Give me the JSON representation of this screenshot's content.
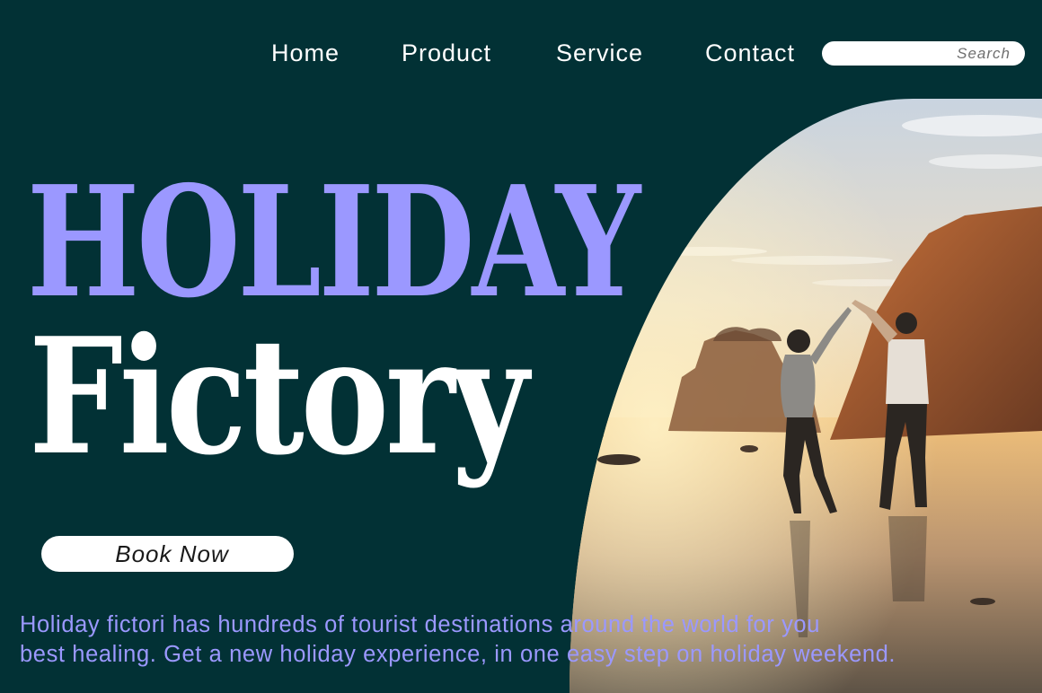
{
  "nav": {
    "items": [
      "Home",
      "Product",
      "Service",
      "Contact"
    ],
    "search_placeholder": "Search"
  },
  "hero": {
    "title_line1": "HOLIDAY",
    "title_line2": "Fictory",
    "cta_label": "Book Now",
    "description_line1": "Holiday fictori has hundreds of tourist destinations around the world for you",
    "description_line2": "best healing. Get a new holiday experience, in one easy step on holiday weekend."
  },
  "image": {
    "subject": "couple-dancing-on-beach-at-sunset-photo"
  },
  "colors": {
    "background": "#023135",
    "accent": "#9b98ff",
    "text_light": "#ffffff"
  }
}
